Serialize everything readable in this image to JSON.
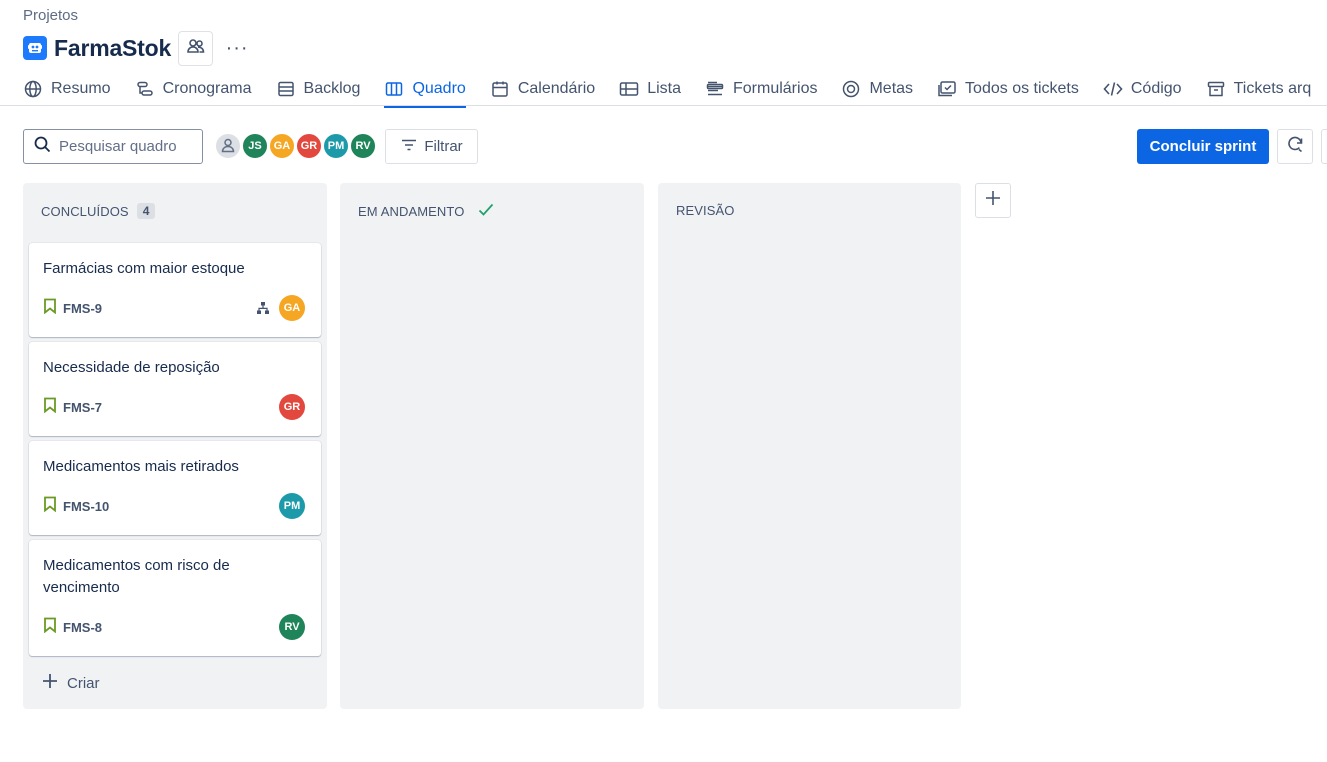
{
  "breadcrumb": "Projetos",
  "project": {
    "title": "FarmaStok",
    "icon": "project-board-icon",
    "more_label": "···"
  },
  "tabs": [
    {
      "label": "Resumo",
      "icon": "globe-icon"
    },
    {
      "label": "Cronograma",
      "icon": "timeline-icon"
    },
    {
      "label": "Backlog",
      "icon": "backlog-icon"
    },
    {
      "label": "Quadro",
      "icon": "board-icon",
      "active": true
    },
    {
      "label": "Calendário",
      "icon": "calendar-icon"
    },
    {
      "label": "Lista",
      "icon": "list-icon"
    },
    {
      "label": "Formulários",
      "icon": "forms-icon"
    },
    {
      "label": "Metas",
      "icon": "target-icon"
    },
    {
      "label": "Todos os tickets",
      "icon": "tickets-icon"
    },
    {
      "label": "Código",
      "icon": "code-icon"
    },
    {
      "label": "Tickets arq",
      "icon": "archive-icon"
    }
  ],
  "toolbar": {
    "search_placeholder": "Pesquisar quadro",
    "filter_label": "Filtrar",
    "complete_sprint_label": "Concluir sprint"
  },
  "assignees": [
    {
      "initials": "JS",
      "color": "#1f845a"
    },
    {
      "initials": "GA",
      "color": "#f5a623"
    },
    {
      "initials": "GR",
      "color": "#e2483d"
    },
    {
      "initials": "PM",
      "color": "#1d9aaa"
    },
    {
      "initials": "RV",
      "color": "#1f845a"
    }
  ],
  "columns": [
    {
      "name": "CONCLUÍDOS",
      "count": "4",
      "cards": [
        {
          "title": "Farmácias com maior estoque",
          "key": "FMS-9",
          "assignee": "GA",
          "color": "#f5a623",
          "has_children": true
        },
        {
          "title": "Necessidade de reposição",
          "key": "FMS-7",
          "assignee": "GR",
          "color": "#e2483d"
        },
        {
          "title": "Medicamentos mais retirados",
          "key": "FMS-10",
          "assignee": "PM",
          "color": "#1d9aaa"
        },
        {
          "title": "Medicamentos com risco de vencimento",
          "key": "FMS-8",
          "assignee": "RV",
          "color": "#1f845a"
        }
      ],
      "create_label": "Criar"
    },
    {
      "name": "EM ANDAMENTO",
      "done_marker": true
    },
    {
      "name": "REVISÃO"
    }
  ],
  "colors": {
    "accent": "#0c66e4",
    "story": "#6a9a23",
    "column_bg": "#f1f2f4"
  }
}
